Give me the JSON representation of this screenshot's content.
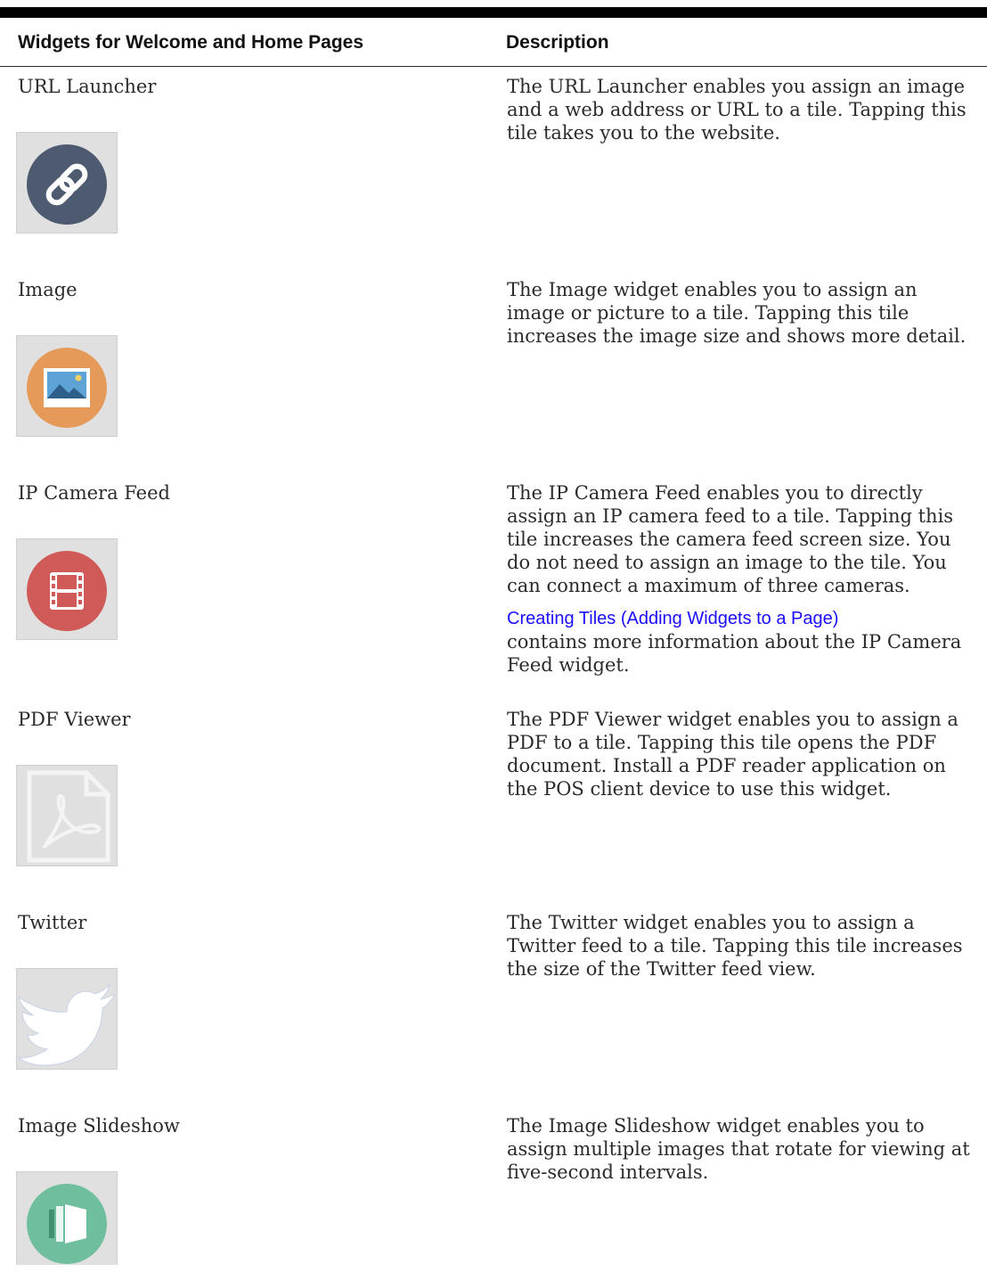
{
  "table": {
    "headers": [
      "Widgets for Welcome and Home Pages",
      "Description"
    ],
    "rows": [
      {
        "name": "URL Launcher",
        "icon": "link-icon",
        "icon_color": "#4d5a70",
        "description": "The URL Launcher enables you assign an image and a web address or URL to a tile. Tapping this tile takes you to the website."
      },
      {
        "name": "Image",
        "icon": "picture-icon",
        "icon_color": "#e69a5a",
        "description": "The Image widget enables you to assign an image or picture to a tile. Tapping this tile increases the image size and shows more detail."
      },
      {
        "name": "IP Camera Feed",
        "icon": "film-icon",
        "icon_color": "#cf5a57",
        "description": "The IP Camera Feed enables you to directly assign an IP camera feed to a tile. Tapping this tile increases the camera feed screen size. You do not need to assign an image to the tile. You can connect a maximum of three cameras.",
        "link_text": "Creating Tiles (Adding Widgets to a Page)",
        "link_suffix": "contains more information about the IP Camera Feed widget."
      },
      {
        "name": "PDF Viewer",
        "icon": "pdf-icon",
        "icon_color": "#ffffff",
        "description": "The PDF Viewer widget enables you to assign a PDF to a tile. Tapping this tile opens the PDF document. Install a PDF reader application on the POS client device to use this widget."
      },
      {
        "name": "Twitter",
        "icon": "twitter-bird-icon",
        "icon_color": "#ffffff",
        "description": "The Twitter widget enables you to assign a Twitter feed to a tile. Tapping this tile increases the size of the Twitter feed view."
      },
      {
        "name": "Image Slideshow",
        "icon": "slideshow-icon",
        "icon_color": "#6fbf9f",
        "description": "The Image Slideshow widget enables you to assign multiple images that rotate for viewing at five-second intervals."
      }
    ]
  }
}
